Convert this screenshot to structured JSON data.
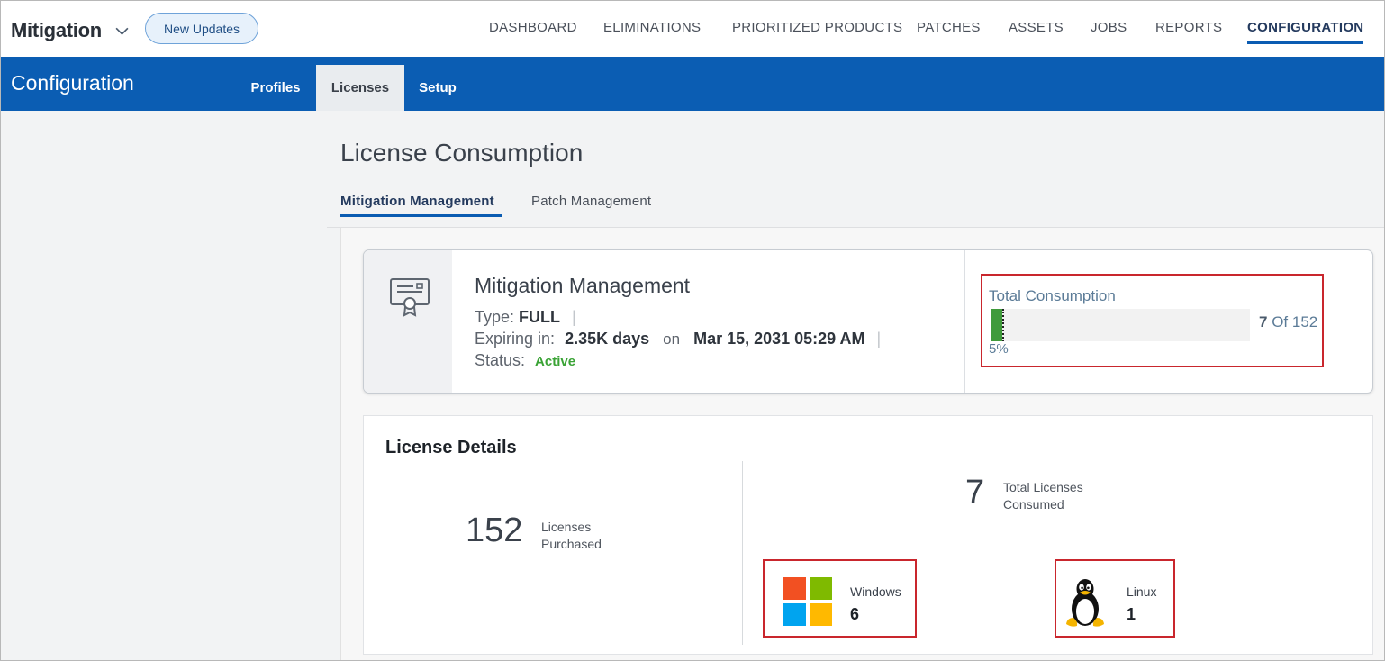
{
  "app": {
    "name": "Mitigation",
    "updates_button": "New Updates"
  },
  "topnav": [
    "DASHBOARD",
    "ELIMINATIONS",
    "PRIORITIZED PRODUCTS",
    "PATCHES",
    "ASSETS",
    "JOBS",
    "REPORTS",
    "CONFIGURATION"
  ],
  "topnav_active": "CONFIGURATION",
  "section": {
    "title": "Configuration",
    "tabs": [
      "Profiles",
      "Licenses",
      "Setup"
    ],
    "active_tab": "Licenses"
  },
  "page": {
    "title": "License Consumption",
    "tabs": [
      "Mitigation Management",
      "Patch Management"
    ],
    "active_tab": "Mitigation Management"
  },
  "license": {
    "name": "Mitigation Management",
    "type_label": "Type:",
    "type_value": "FULL",
    "expiring_label": "Expiring in:",
    "expiring_value": "2.35K days",
    "on_label": "on",
    "expiry_date": "Mar 15, 2031 05:29 AM",
    "status_label": "Status:",
    "status_value": "Active",
    "separator": "|"
  },
  "consumption": {
    "title": "Total Consumption",
    "consumed": "7",
    "of_text": "Of 152",
    "percent_label": "5%",
    "fraction": 0.046
  },
  "details": {
    "title": "License Details",
    "purchased_value": "152",
    "purchased_label_1": "Licenses",
    "purchased_label_2": "Purchased",
    "consumed_value": "7",
    "consumed_label_1": "Total Licenses",
    "consumed_label_2": "Consumed",
    "os": [
      {
        "name": "Windows",
        "count": "6",
        "icon": "windows-logo-icon"
      },
      {
        "name": "Linux",
        "count": "1",
        "icon": "linux-penguin-icon"
      }
    ]
  },
  "colors": {
    "brand_blue": "#0b5db3",
    "highlight_red": "#c9262d",
    "active_green": "#3aa335",
    "progress_green": "#3f9a3b"
  }
}
